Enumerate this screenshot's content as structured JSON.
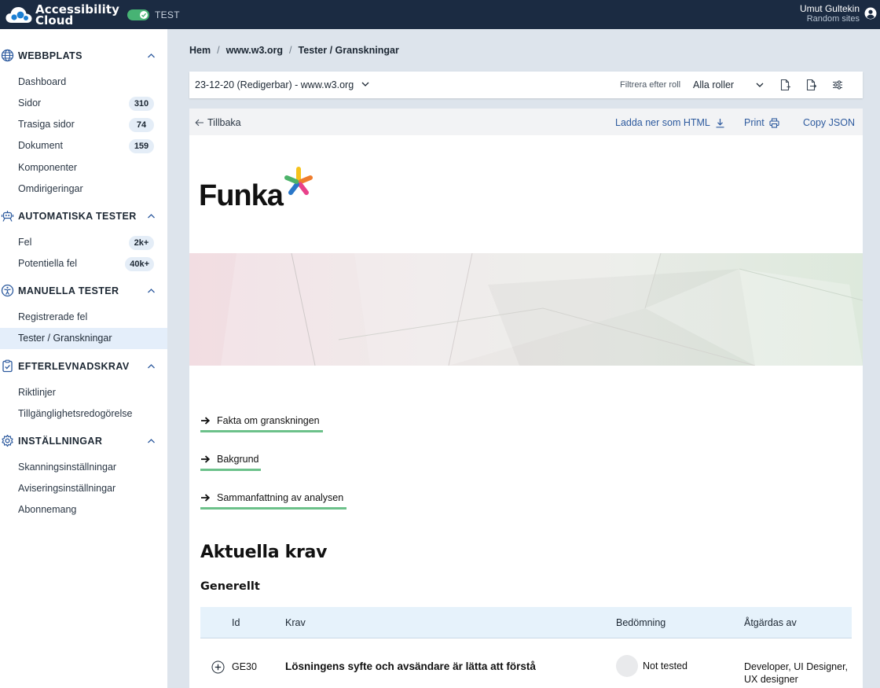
{
  "topbar": {
    "brand_line1": "Accessibility",
    "brand_line2": "Cloud",
    "env_label": "TEST",
    "user_name": "Umut Gultekin",
    "user_org": "Random sites",
    "toggle_color": "#47b374"
  },
  "sidebar": {
    "sections": [
      {
        "title": "WEBBPLATS",
        "icon": "globe-icon"
      },
      {
        "title": "AUTOMATISKA TESTER",
        "icon": "robot-icon"
      },
      {
        "title": "MANUELLA TESTER",
        "icon": "accessibility-person-icon"
      },
      {
        "title": "EFTERLEVNADSKRAV",
        "icon": "clipboard-check-icon"
      },
      {
        "title": "INSTÄLLNINGAR",
        "icon": "gear-icon"
      }
    ],
    "webbplats": [
      {
        "label": "Dashboard"
      },
      {
        "label": "Sidor",
        "badge": "310"
      },
      {
        "label": "Trasiga sidor",
        "badge": "74"
      },
      {
        "label": "Dokument",
        "badge": "159"
      },
      {
        "label": "Komponenter"
      },
      {
        "label": "Omdirigeringar"
      }
    ],
    "automatiska": [
      {
        "label": "Fel",
        "badge": "2k+"
      },
      {
        "label": "Potentiella fel",
        "badge": "40k+"
      }
    ],
    "manuella": [
      {
        "label": "Registrerade fel"
      },
      {
        "label": "Tester / Granskningar",
        "active": true
      }
    ],
    "efterlevnad": [
      {
        "label": "Riktlinjer"
      },
      {
        "label": "Tillgänglighetsredogörelse"
      }
    ],
    "installningar": [
      {
        "label": "Skanningsinställningar"
      },
      {
        "label": "Aviseringsinställningar"
      },
      {
        "label": "Abonnemang"
      }
    ]
  },
  "breadcrumb": {
    "items": [
      "Hem",
      "www.w3.org",
      "Tester / Granskningar"
    ],
    "separator": "/"
  },
  "filterbar": {
    "selected_test": "23-12-20 (Redigerbar) - www.w3.org",
    "filter_label": "Filtrera efter roll",
    "role_value": "Alla roller"
  },
  "toolbar": {
    "back": "Tillbaka",
    "download": "Ladda ner som HTML",
    "print": "Print",
    "copy_json": "Copy JSON",
    "link_color": "#2d5a9e"
  },
  "report": {
    "logo_text": "Funka",
    "toc": [
      "Fakta om granskningen",
      "Bakgrund",
      "Sammanfattning av analysen"
    ],
    "heading": "Aktuella krav",
    "subheading": "Generellt",
    "table": {
      "headers": {
        "id": "Id",
        "krav": "Krav",
        "bedomning": "Bedömning",
        "atgardas": "Åtgärdas av"
      },
      "rows": [
        {
          "id": "GE30",
          "krav": "Lösningens syfte och avsändare är lätta att förstå",
          "status": "Not tested",
          "atgardas_line1": "Developer, UI Designer,",
          "atgardas_line2": "UX designer"
        }
      ]
    },
    "accent_color": "#6cc18a"
  }
}
